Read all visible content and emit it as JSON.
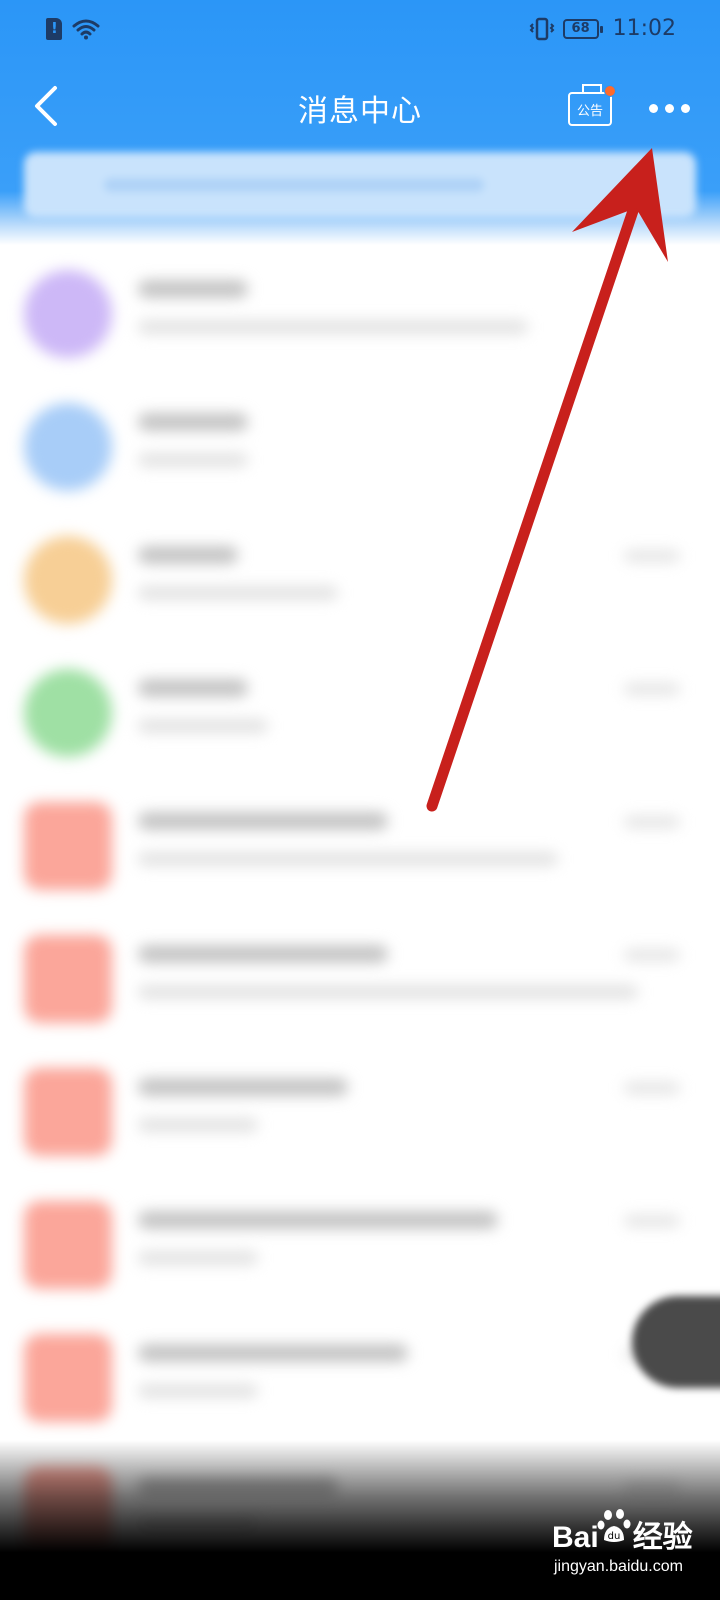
{
  "status_bar": {
    "battery": "68",
    "time": "11:02"
  },
  "nav": {
    "title": "消息中心",
    "notice_label": "公告"
  },
  "list": {
    "rows": [
      {
        "avatar_color": "#cdb8f7",
        "shape": "circle"
      },
      {
        "avatar_color": "#a8cdf8",
        "shape": "circle"
      },
      {
        "avatar_color": "#f7cf96",
        "shape": "circle"
      },
      {
        "avatar_color": "#9fe0a4",
        "shape": "circle"
      },
      {
        "avatar_color": "#fba69a",
        "shape": "square"
      },
      {
        "avatar_color": "#fba69a",
        "shape": "square"
      },
      {
        "avatar_color": "#fba69a",
        "shape": "square"
      },
      {
        "avatar_color": "#fba69a",
        "shape": "square"
      },
      {
        "avatar_color": "#fba69a",
        "shape": "square"
      },
      {
        "avatar_color": "#fba69a",
        "shape": "square"
      }
    ]
  },
  "watermark": {
    "brand_left": "Bai",
    "brand_right": "经验",
    "url": "jingyan.baidu.com"
  },
  "colors": {
    "header_blue": "#2b96f7",
    "arrow_red": "#c8201c",
    "notice_dot": "#ff6a2a"
  }
}
